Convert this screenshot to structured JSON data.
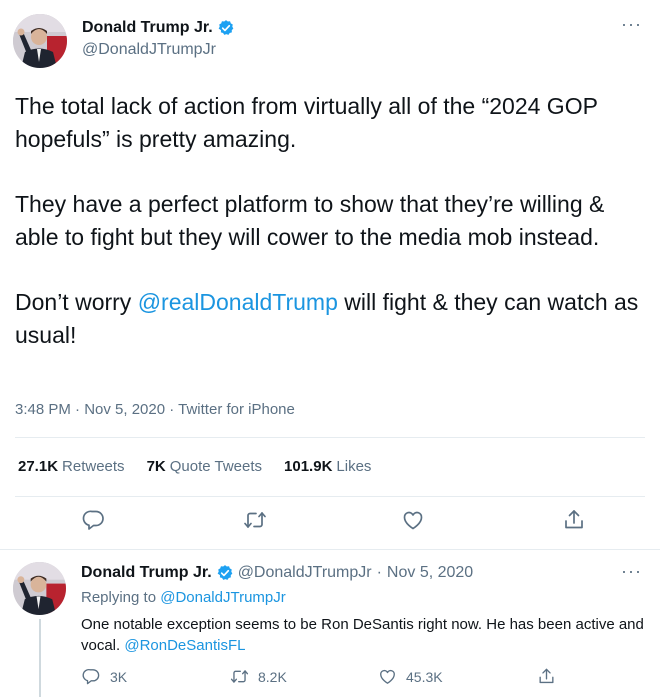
{
  "main_tweet": {
    "author_name": "Donald Trump Jr.",
    "author_handle": "@DonaldJTrumpJr",
    "text_p1": "The total lack of action from virtually all of the “2024 GOP hopefuls” is pretty amazing.",
    "text_p2": "They have a perfect platform to show that they’re willing & able to fight but they will cower to the media mob instead.",
    "text_p3_before": "Don’t worry ",
    "text_p3_mention": "@realDonaldTrump",
    "text_p3_after": " will fight & they can watch as usual!",
    "timestamp": "3:48 PM · Nov 5, 2020 · Twitter for iPhone",
    "stats": {
      "retweets_count": "27.1K",
      "retweets_label": "Retweets",
      "quotes_count": "7K",
      "quotes_label": "Quote Tweets",
      "likes_count": "101.9K",
      "likes_label": "Likes"
    },
    "more_label": "···"
  },
  "reply_tweet": {
    "author_name": "Donald Trump Jr.",
    "author_handle": "@DonaldJTrumpJr",
    "separator": "·",
    "date": "Nov 5, 2020",
    "replying_to_label": "Replying to ",
    "replying_to_handle": "@DonaldJTrumpJr",
    "text": "One notable exception seems to be Ron DeSantis right now. He has been active and vocal. ",
    "text_mention": "@RonDeSantisFL",
    "reply_count": "3K",
    "retweet_count": "8.2K",
    "like_count": "45.3K",
    "more_label": "···"
  },
  "icons": {
    "verified": "verified-badge-icon",
    "reply": "reply-icon",
    "retweet": "retweet-icon",
    "like": "like-icon",
    "share": "share-icon",
    "more": "more-icon"
  },
  "colors": {
    "link": "#1b95e0",
    "verified": "#1da1f2",
    "secondary_text": "#5b7083",
    "divider": "#e6ecf0"
  }
}
